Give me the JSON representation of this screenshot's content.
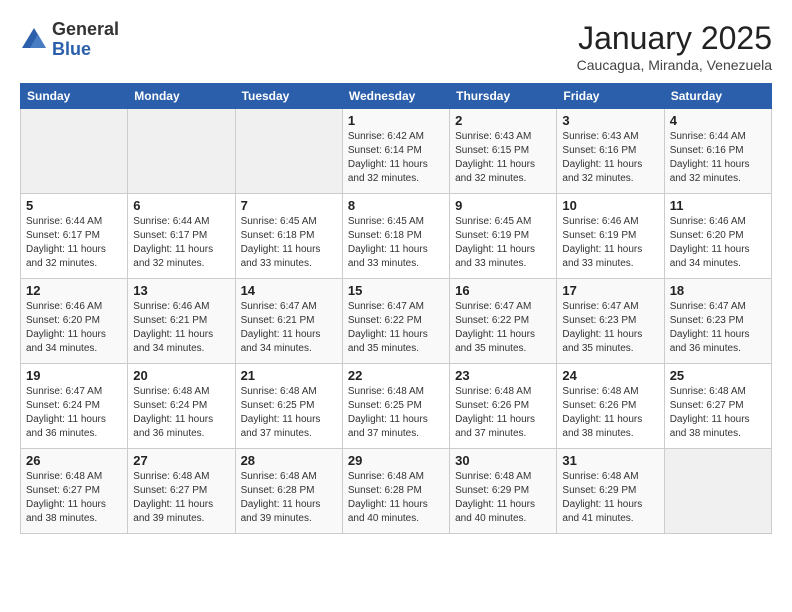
{
  "header": {
    "logo_general": "General",
    "logo_blue": "Blue",
    "title": "January 2025",
    "location": "Caucagua, Miranda, Venezuela"
  },
  "weekdays": [
    "Sunday",
    "Monday",
    "Tuesday",
    "Wednesday",
    "Thursday",
    "Friday",
    "Saturday"
  ],
  "weeks": [
    [
      {
        "day": "",
        "text": ""
      },
      {
        "day": "",
        "text": ""
      },
      {
        "day": "",
        "text": ""
      },
      {
        "day": "1",
        "text": "Sunrise: 6:42 AM\nSunset: 6:14 PM\nDaylight: 11 hours and 32 minutes."
      },
      {
        "day": "2",
        "text": "Sunrise: 6:43 AM\nSunset: 6:15 PM\nDaylight: 11 hours and 32 minutes."
      },
      {
        "day": "3",
        "text": "Sunrise: 6:43 AM\nSunset: 6:16 PM\nDaylight: 11 hours and 32 minutes."
      },
      {
        "day": "4",
        "text": "Sunrise: 6:44 AM\nSunset: 6:16 PM\nDaylight: 11 hours and 32 minutes."
      }
    ],
    [
      {
        "day": "5",
        "text": "Sunrise: 6:44 AM\nSunset: 6:17 PM\nDaylight: 11 hours and 32 minutes."
      },
      {
        "day": "6",
        "text": "Sunrise: 6:44 AM\nSunset: 6:17 PM\nDaylight: 11 hours and 32 minutes."
      },
      {
        "day": "7",
        "text": "Sunrise: 6:45 AM\nSunset: 6:18 PM\nDaylight: 11 hours and 33 minutes."
      },
      {
        "day": "8",
        "text": "Sunrise: 6:45 AM\nSunset: 6:18 PM\nDaylight: 11 hours and 33 minutes."
      },
      {
        "day": "9",
        "text": "Sunrise: 6:45 AM\nSunset: 6:19 PM\nDaylight: 11 hours and 33 minutes."
      },
      {
        "day": "10",
        "text": "Sunrise: 6:46 AM\nSunset: 6:19 PM\nDaylight: 11 hours and 33 minutes."
      },
      {
        "day": "11",
        "text": "Sunrise: 6:46 AM\nSunset: 6:20 PM\nDaylight: 11 hours and 34 minutes."
      }
    ],
    [
      {
        "day": "12",
        "text": "Sunrise: 6:46 AM\nSunset: 6:20 PM\nDaylight: 11 hours and 34 minutes."
      },
      {
        "day": "13",
        "text": "Sunrise: 6:46 AM\nSunset: 6:21 PM\nDaylight: 11 hours and 34 minutes."
      },
      {
        "day": "14",
        "text": "Sunrise: 6:47 AM\nSunset: 6:21 PM\nDaylight: 11 hours and 34 minutes."
      },
      {
        "day": "15",
        "text": "Sunrise: 6:47 AM\nSunset: 6:22 PM\nDaylight: 11 hours and 35 minutes."
      },
      {
        "day": "16",
        "text": "Sunrise: 6:47 AM\nSunset: 6:22 PM\nDaylight: 11 hours and 35 minutes."
      },
      {
        "day": "17",
        "text": "Sunrise: 6:47 AM\nSunset: 6:23 PM\nDaylight: 11 hours and 35 minutes."
      },
      {
        "day": "18",
        "text": "Sunrise: 6:47 AM\nSunset: 6:23 PM\nDaylight: 11 hours and 36 minutes."
      }
    ],
    [
      {
        "day": "19",
        "text": "Sunrise: 6:47 AM\nSunset: 6:24 PM\nDaylight: 11 hours and 36 minutes."
      },
      {
        "day": "20",
        "text": "Sunrise: 6:48 AM\nSunset: 6:24 PM\nDaylight: 11 hours and 36 minutes."
      },
      {
        "day": "21",
        "text": "Sunrise: 6:48 AM\nSunset: 6:25 PM\nDaylight: 11 hours and 37 minutes."
      },
      {
        "day": "22",
        "text": "Sunrise: 6:48 AM\nSunset: 6:25 PM\nDaylight: 11 hours and 37 minutes."
      },
      {
        "day": "23",
        "text": "Sunrise: 6:48 AM\nSunset: 6:26 PM\nDaylight: 11 hours and 37 minutes."
      },
      {
        "day": "24",
        "text": "Sunrise: 6:48 AM\nSunset: 6:26 PM\nDaylight: 11 hours and 38 minutes."
      },
      {
        "day": "25",
        "text": "Sunrise: 6:48 AM\nSunset: 6:27 PM\nDaylight: 11 hours and 38 minutes."
      }
    ],
    [
      {
        "day": "26",
        "text": "Sunrise: 6:48 AM\nSunset: 6:27 PM\nDaylight: 11 hours and 38 minutes."
      },
      {
        "day": "27",
        "text": "Sunrise: 6:48 AM\nSunset: 6:27 PM\nDaylight: 11 hours and 39 minutes."
      },
      {
        "day": "28",
        "text": "Sunrise: 6:48 AM\nSunset: 6:28 PM\nDaylight: 11 hours and 39 minutes."
      },
      {
        "day": "29",
        "text": "Sunrise: 6:48 AM\nSunset: 6:28 PM\nDaylight: 11 hours and 40 minutes."
      },
      {
        "day": "30",
        "text": "Sunrise: 6:48 AM\nSunset: 6:29 PM\nDaylight: 11 hours and 40 minutes."
      },
      {
        "day": "31",
        "text": "Sunrise: 6:48 AM\nSunset: 6:29 PM\nDaylight: 11 hours and 41 minutes."
      },
      {
        "day": "",
        "text": ""
      }
    ]
  ]
}
